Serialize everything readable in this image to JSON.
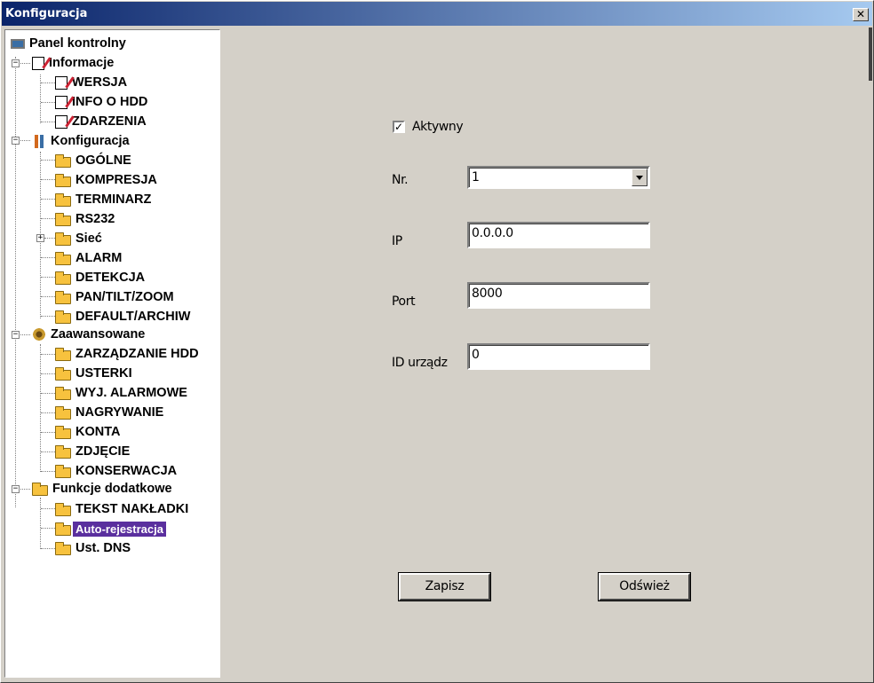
{
  "window": {
    "title": "Konfiguracja",
    "close_label": "✕"
  },
  "tree": {
    "root": "Panel kontrolny",
    "info": {
      "label": "Informacje",
      "items": [
        "WERSJA",
        "INFO O HDD",
        "ZDARZENIA"
      ]
    },
    "config": {
      "label": "Konfiguracja",
      "items": [
        "OGÓLNE",
        "KOMPRESJA",
        "TERMINARZ",
        "RS232",
        "Sieć",
        "ALARM",
        "DETEKCJA",
        "PAN/TILT/ZOOM",
        "DEFAULT/ARCHIW"
      ]
    },
    "advanced": {
      "label": "Zaawansowane",
      "items": [
        "ZARZĄDZANIE HDD",
        "USTERKI",
        "WYJ. ALARMOWE",
        "NAGRYWANIE",
        "KONTA",
        "ZDJĘCIE",
        "KONSERWACJA"
      ]
    },
    "extra": {
      "label": "Funkcje dodatkowe",
      "items": [
        "TEKST NAKŁADKI",
        "Auto-rejestracja",
        "Ust. DNS"
      ]
    }
  },
  "form": {
    "active": {
      "label": "Aktywny",
      "checked": true,
      "mark": "✓"
    },
    "nr": {
      "label": "Nr.",
      "value": "1"
    },
    "ip": {
      "label": "IP",
      "value": "0.0.0.0"
    },
    "port": {
      "label": "Port",
      "value": "8000"
    },
    "device_id": {
      "label": "ID urządz",
      "value": "0"
    },
    "save_label": "Zapisz",
    "refresh_label": "Odśwież"
  },
  "colors": {
    "titlebar": "#0a246a",
    "selection": "#5a2f9e",
    "face": "#d4d0c8"
  },
  "icons": {
    "root": "computer-icon",
    "info": "document-icon",
    "config": "tools-icon",
    "advanced": "gears-icon",
    "item": "folder-icon",
    "expand": "plus-icon",
    "collapse": "minus-icon"
  }
}
